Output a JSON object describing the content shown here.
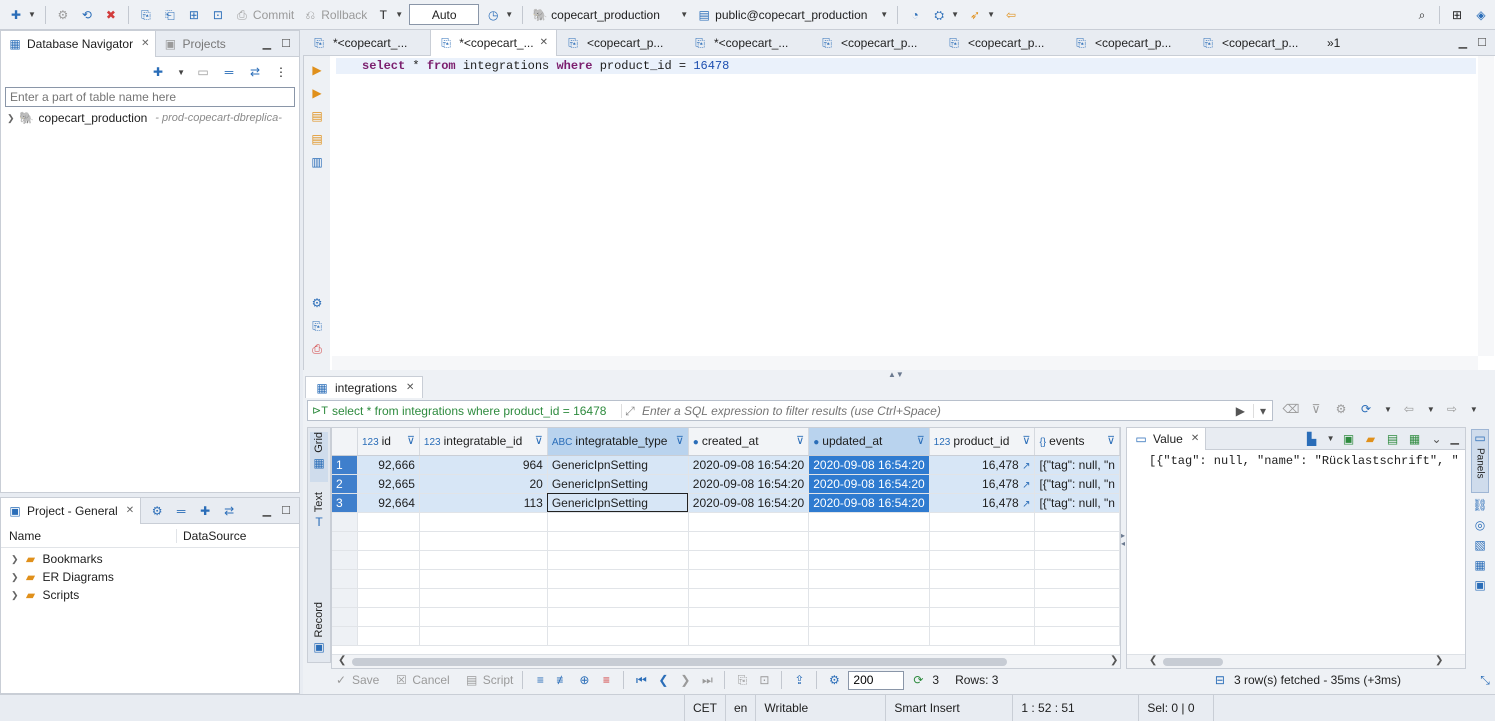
{
  "toolbar": {
    "commit": "Commit",
    "rollback": "Rollback",
    "auto": "Auto",
    "connection": "copecart_production",
    "schema": "public@copecart_production"
  },
  "navigator": {
    "tab_label": "Database Navigator",
    "projects_tab": "Projects",
    "filter_placeholder": "Enter a part of table name here",
    "tree": [
      {
        "name": "copecart_production",
        "host": "- prod-copecart-dbreplica-"
      }
    ]
  },
  "project_panel": {
    "tab_label": "Project - General",
    "col_name": "Name",
    "col_datasource": "DataSource",
    "items": [
      "Bookmarks",
      "ER Diagrams",
      "Scripts"
    ]
  },
  "editor_tabs": [
    "*<copecart_...",
    "*<copecart_...",
    "<copecart_p...",
    "*<copecart_...",
    "<copecart_p...",
    "<copecart_p...",
    "<copecart_p...",
    "<copecart_p..."
  ],
  "editor_tabs_overflow": "»1",
  "sql": {
    "kw1": "select",
    "star": "*",
    "kw2": "from",
    "table": "integrations",
    "kw3": "where",
    "col": "product_id",
    "eq": "=",
    "value": "16478"
  },
  "results": {
    "tab_label": "integrations",
    "query_text": "select * from integrations where product_id = 16478",
    "filter_placeholder": "Enter a SQL expression to filter results (use Ctrl+Space)",
    "side_grid": "Grid",
    "side_text": "Text",
    "side_record": "Record",
    "columns": [
      {
        "type": "123",
        "name": "id"
      },
      {
        "type": "123",
        "name": "integratable_id"
      },
      {
        "type": "ABC",
        "name": "integratable_type"
      },
      {
        "type": "clock",
        "name": "created_at"
      },
      {
        "type": "clock",
        "name": "updated_at"
      },
      {
        "type": "123",
        "name": "product_id"
      },
      {
        "type": "json",
        "name": "events"
      }
    ],
    "rows": [
      {
        "n": "1",
        "id": "92,666",
        "integratable_id": "964",
        "integratable_type": "GenericIpnSetting",
        "created_at": "2020-09-08 16:54:20",
        "updated_at": "2020-09-08 16:54:20",
        "product_id": "16,478",
        "events": "[{\"tag\": null, \"n"
      },
      {
        "n": "2",
        "id": "92,665",
        "integratable_id": "20",
        "integratable_type": "GenericIpnSetting",
        "created_at": "2020-09-08 16:54:20",
        "updated_at": "2020-09-08 16:54:20",
        "product_id": "16,478",
        "events": "[{\"tag\": null, \"n"
      },
      {
        "n": "3",
        "id": "92,664",
        "integratable_id": "113",
        "integratable_type": "GenericIpnSetting",
        "created_at": "2020-09-08 16:54:20",
        "updated_at": "2020-09-08 16:54:20",
        "product_id": "16,478",
        "events": "[{\"tag\": null, \"n"
      }
    ],
    "value_panel": {
      "tab_label": "Value",
      "content": "[{\"tag\": null, \"name\": \"Rücklastschrift\", \"",
      "panels_label": "Panels"
    },
    "bottom": {
      "save": "Save",
      "cancel": "Cancel",
      "script": "Script",
      "fetch_size": "200",
      "refresh_count": "3",
      "rows": "Rows: 3",
      "fetched": "3 row(s) fetched - 35ms (+3ms)"
    }
  },
  "statusbar": {
    "tz": "CET",
    "lang": "en",
    "mode": "Writable",
    "insert": "Smart Insert",
    "pos": "1 : 52 : 51",
    "sel": "Sel: 0 | 0"
  }
}
